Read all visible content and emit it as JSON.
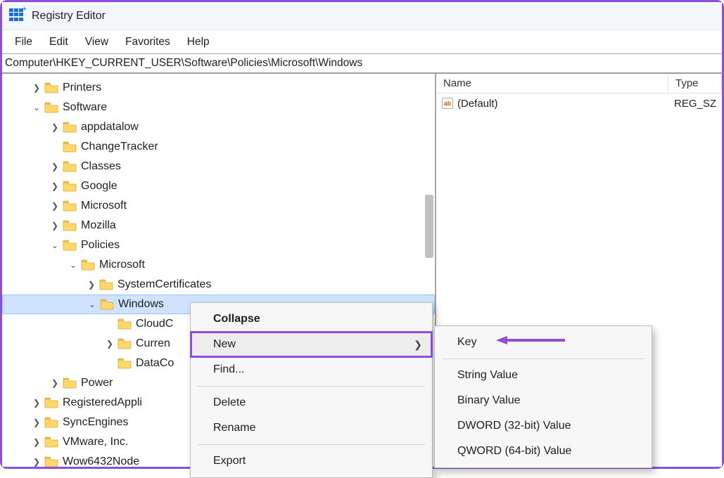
{
  "window": {
    "title": "Registry Editor"
  },
  "menu": {
    "items": [
      "File",
      "Edit",
      "View",
      "Favorites",
      "Help"
    ]
  },
  "address": "Computer\\HKEY_CURRENT_USER\\Software\\Policies\\Microsoft\\Windows",
  "list": {
    "columns": {
      "name": "Name",
      "type": "Type"
    },
    "rows": [
      {
        "name": "(Default)",
        "type": "REG_SZ"
      }
    ]
  },
  "tree": [
    {
      "depth": 0,
      "toggle": ">",
      "label": "Printers"
    },
    {
      "depth": 0,
      "toggle": "v",
      "label": "Software"
    },
    {
      "depth": 1,
      "toggle": ">",
      "label": "appdatalow"
    },
    {
      "depth": 1,
      "toggle": "",
      "label": "ChangeTracker"
    },
    {
      "depth": 1,
      "toggle": ">",
      "label": "Classes"
    },
    {
      "depth": 1,
      "toggle": ">",
      "label": "Google"
    },
    {
      "depth": 1,
      "toggle": ">",
      "label": "Microsoft"
    },
    {
      "depth": 1,
      "toggle": ">",
      "label": "Mozilla"
    },
    {
      "depth": 1,
      "toggle": "v",
      "label": "Policies"
    },
    {
      "depth": 2,
      "toggle": "v",
      "label": "Microsoft"
    },
    {
      "depth": 3,
      "toggle": ">",
      "label": "SystemCertificates"
    },
    {
      "depth": 3,
      "toggle": "v",
      "label": "Windows",
      "selected": true
    },
    {
      "depth": 4,
      "toggle": "",
      "label": "CloudC"
    },
    {
      "depth": 4,
      "toggle": ">",
      "label": "Curren"
    },
    {
      "depth": 4,
      "toggle": "",
      "label": "DataCo"
    },
    {
      "depth": 1,
      "toggle": ">",
      "label": "Power"
    },
    {
      "depth": 0,
      "toggle": ">",
      "label": "RegisteredAppli"
    },
    {
      "depth": 0,
      "toggle": ">",
      "label": "SyncEngines"
    },
    {
      "depth": 0,
      "toggle": ">",
      "label": "VMware, Inc."
    },
    {
      "depth": 0,
      "toggle": ">",
      "label": "Wow6432Node"
    }
  ],
  "context_menu_1": {
    "items": [
      {
        "label": "Collapse",
        "bold": true
      },
      {
        "label": "New",
        "submenu": true,
        "highlighted": true
      },
      {
        "label": "Find..."
      },
      {
        "sep": true
      },
      {
        "label": "Delete"
      },
      {
        "label": "Rename"
      },
      {
        "sep": true
      },
      {
        "label": "Export"
      }
    ]
  },
  "context_menu_2": {
    "items": [
      {
        "label": "Key",
        "arrow_annot": true
      },
      {
        "sep": true
      },
      {
        "label": "String Value"
      },
      {
        "label": "Binary Value"
      },
      {
        "label": "DWORD (32-bit) Value"
      },
      {
        "label": "QWORD (64-bit) Value"
      }
    ]
  }
}
